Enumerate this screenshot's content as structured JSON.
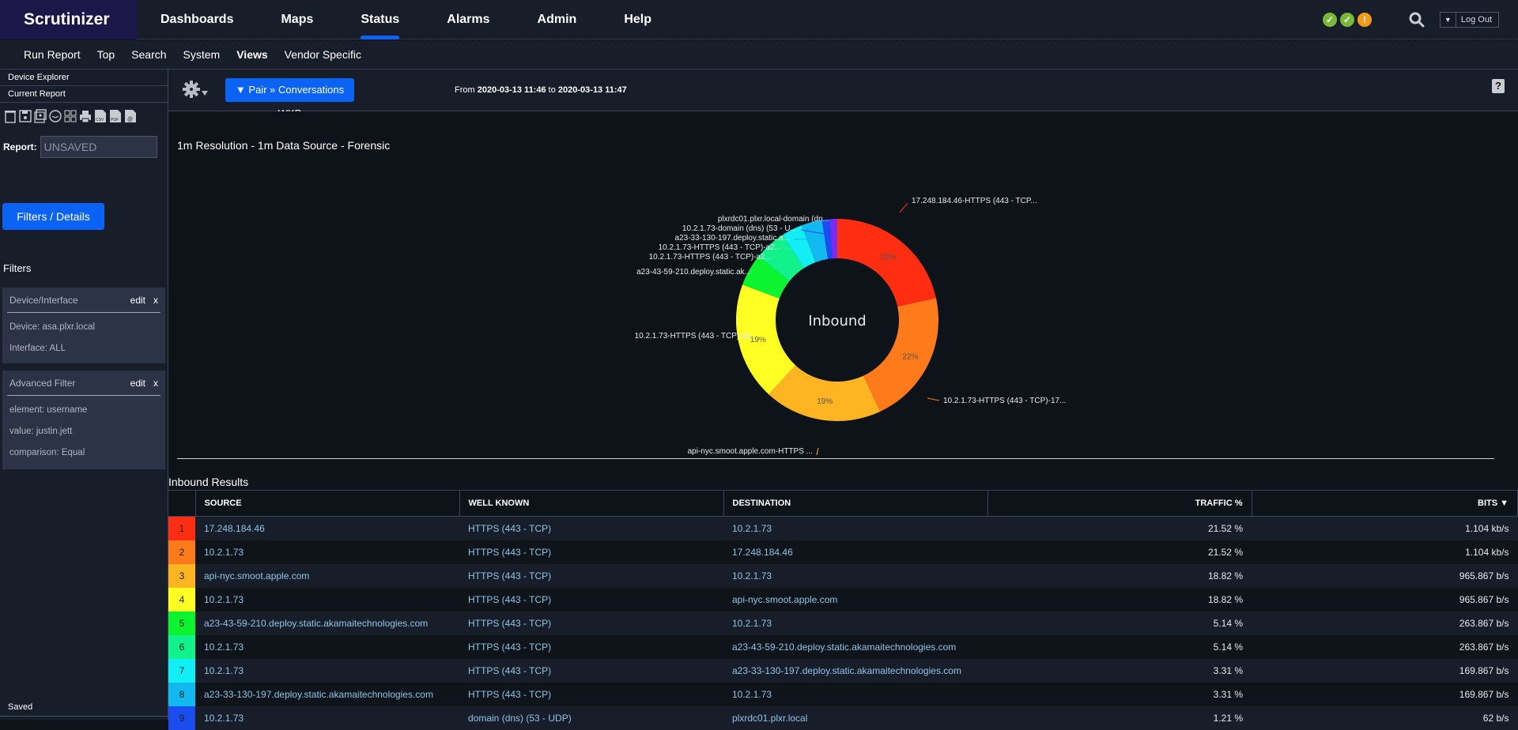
{
  "app": {
    "logo": "Scrutinizer"
  },
  "nav": {
    "items": [
      {
        "label": "Dashboards",
        "active": false
      },
      {
        "label": "Maps",
        "active": false
      },
      {
        "label": "Status",
        "active": true
      },
      {
        "label": "Alarms",
        "active": false
      },
      {
        "label": "Admin",
        "active": false
      },
      {
        "label": "Help",
        "active": false
      }
    ],
    "status_icons": [
      {
        "icon": "check-icon",
        "glyph": "✓",
        "color": "#7ab83a"
      },
      {
        "icon": "check-icon",
        "glyph": "✓",
        "color": "#7ab83a"
      },
      {
        "icon": "warning-icon",
        "glyph": "!",
        "color": "#f59a1a"
      }
    ],
    "logout_label": "Log Out"
  },
  "subnav": {
    "items": [
      {
        "label": "Run Report",
        "bold": false
      },
      {
        "label": "Top",
        "bold": false
      },
      {
        "label": "Search",
        "bold": false
      },
      {
        "label": "System",
        "bold": false
      },
      {
        "label": "Views",
        "bold": true
      },
      {
        "label": "Vendor Specific",
        "bold": false
      }
    ]
  },
  "sidebar": {
    "tabs": [
      "Device Explorer",
      "Current Report"
    ],
    "toolbar_icons": [
      "trash-icon",
      "save-icon",
      "save-as-icon",
      "clock-icon",
      "grid-icon",
      "print-icon",
      "csv-icon",
      "pdf-icon",
      "email-icon"
    ],
    "report_label": "Report:",
    "report_value": "UNSAVED",
    "filters_button": "Filters / Details",
    "filters_title": "Filters",
    "filter_cards": [
      {
        "title": "Device/Interface",
        "edit": "edit",
        "remove": "x",
        "lines": [
          "Device: asa.plxr.local",
          "Interface: ALL"
        ]
      },
      {
        "title": "Advanced Filter",
        "edit": "edit",
        "remove": "x",
        "lines": [
          "element: username",
          "value: justin.jett",
          "comparison: Equal"
        ]
      }
    ],
    "saved_label": "Saved"
  },
  "main": {
    "pair_button": "▼ Pair » Conversations WKP",
    "date_from_label": "From",
    "date_from": "2020-03-13 11:46",
    "date_to_label": "to",
    "date_to": "2020-03-13 11:47",
    "help_label": "?",
    "resolution_title": "1m Resolution - 1m Data Source - Forensic",
    "results_title": "Inbound Results"
  },
  "chart_data": {
    "type": "pie",
    "center_label": "Inbound",
    "slices": [
      {
        "label": "17.248.184.46-HTTPS (443 - TCP...",
        "value": 21.52,
        "pct_label": "22%",
        "color": "#ff2d12"
      },
      {
        "label": "10.2.1.73-HTTPS (443 - TCP)-17...",
        "value": 21.52,
        "pct_label": "22%",
        "color": "#ff7a1a"
      },
      {
        "label": "api-nyc.smoot.apple.com-HTTPS ...",
        "value": 18.82,
        "pct_label": "19%",
        "color": "#ffb422"
      },
      {
        "label": "10.2.1.73-HTTPS (443 - TCP)-ap...",
        "value": 18.82,
        "pct_label": "19%",
        "color": "#ffff24"
      },
      {
        "label": "a23-43-59-210.deploy.static.ak...",
        "value": 5.14,
        "pct_label": "",
        "color": "#0cf42f"
      },
      {
        "label": "10.2.1.73-HTTPS (443 - TCP)-a2...",
        "value": 5.14,
        "pct_label": "",
        "color": "#12f28c"
      },
      {
        "label": "10.2.1.73-HTTPS (443 - TCP)-a2...",
        "value": 3.31,
        "pct_label": "",
        "color": "#12eef6"
      },
      {
        "label": "a23-33-130-197.deploy.static.a...",
        "value": 3.31,
        "pct_label": "",
        "color": "#12b8f0"
      },
      {
        "label": "10.2.1.73-domain (dns) (53 - U...",
        "value": 1.21,
        "pct_label": "",
        "color": "#1a4cf0"
      },
      {
        "label": "plxrdc01.plxr.local-domain (dn...",
        "value": 1.21,
        "pct_label": "",
        "color": "#7a2cf0"
      }
    ]
  },
  "table": {
    "columns": [
      "",
      "SOURCE",
      "WELL KNOWN",
      "DESTINATION",
      "TRAFFIC %",
      "BITS ▼"
    ],
    "rows": [
      {
        "rank": "1",
        "color": "#ff2d12",
        "source": "17.248.184.46",
        "well_known": "HTTPS (443 - TCP)",
        "destination": "10.2.1.73",
        "traffic": "21.52 %",
        "bits": "1.104 kb/s"
      },
      {
        "rank": "2",
        "color": "#ff7a1a",
        "source": "10.2.1.73",
        "well_known": "HTTPS (443 - TCP)",
        "destination": "17.248.184.46",
        "traffic": "21.52 %",
        "bits": "1.104 kb/s"
      },
      {
        "rank": "3",
        "color": "#ffb422",
        "source": "api-nyc.smoot.apple.com",
        "well_known": "HTTPS (443 - TCP)",
        "destination": "10.2.1.73",
        "traffic": "18.82 %",
        "bits": "965.867 b/s"
      },
      {
        "rank": "4",
        "color": "#ffff24",
        "source": "10.2.1.73",
        "well_known": "HTTPS (443 - TCP)",
        "destination": "api-nyc.smoot.apple.com",
        "traffic": "18.82 %",
        "bits": "965.867 b/s"
      },
      {
        "rank": "5",
        "color": "#0cf42f",
        "source": "a23-43-59-210.deploy.static.akamaitechnologies.com",
        "well_known": "HTTPS (443 - TCP)",
        "destination": "10.2.1.73",
        "traffic": "5.14 %",
        "bits": "263.867 b/s"
      },
      {
        "rank": "6",
        "color": "#12f28c",
        "source": "10.2.1.73",
        "well_known": "HTTPS (443 - TCP)",
        "destination": "a23-43-59-210.deploy.static.akamaitechnologies.com",
        "traffic": "5.14 %",
        "bits": "263.867 b/s"
      },
      {
        "rank": "7",
        "color": "#12eef6",
        "source": "10.2.1.73",
        "well_known": "HTTPS (443 - TCP)",
        "destination": "a23-33-130-197.deploy.static.akamaitechnologies.com",
        "traffic": "3.31 %",
        "bits": "169.867 b/s"
      },
      {
        "rank": "8",
        "color": "#12b8f0",
        "source": "a23-33-130-197.deploy.static.akamaitechnologies.com",
        "well_known": "HTTPS (443 - TCP)",
        "destination": "10.2.1.73",
        "traffic": "3.31 %",
        "bits": "169.867 b/s"
      },
      {
        "rank": "9",
        "color": "#1a4cf0",
        "source": "10.2.1.73",
        "well_known": "domain (dns) (53 - UDP)",
        "destination": "plxrdc01.plxr.local",
        "traffic": "1.21 %",
        "bits": "62 b/s"
      }
    ]
  }
}
